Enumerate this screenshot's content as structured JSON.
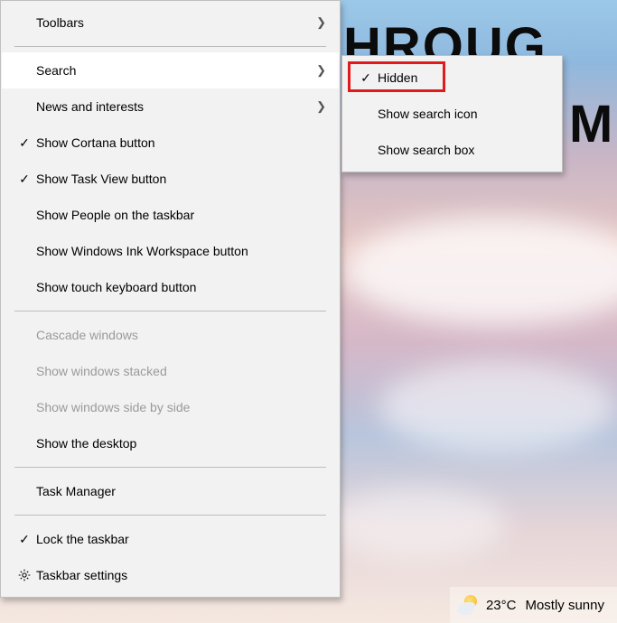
{
  "background": {
    "text_fragment_1": "HROUG",
    "text_fragment_2": "M"
  },
  "main_menu": {
    "items": [
      {
        "label": "Toolbars",
        "icon": null,
        "has_submenu": true,
        "enabled": true
      },
      {
        "label": "Search",
        "icon": null,
        "has_submenu": true,
        "enabled": true,
        "hovered": true
      },
      {
        "label": "News and interests",
        "icon": null,
        "has_submenu": true,
        "enabled": true
      },
      {
        "label": "Show Cortana button",
        "icon": "check",
        "enabled": true
      },
      {
        "label": "Show Task View button",
        "icon": "check",
        "enabled": true
      },
      {
        "label": "Show People on the taskbar",
        "icon": null,
        "enabled": true
      },
      {
        "label": "Show Windows Ink Workspace button",
        "icon": null,
        "enabled": true
      },
      {
        "label": "Show touch keyboard button",
        "icon": null,
        "enabled": true
      },
      {
        "label": "Cascade windows",
        "icon": null,
        "enabled": false
      },
      {
        "label": "Show windows stacked",
        "icon": null,
        "enabled": false
      },
      {
        "label": "Show windows side by side",
        "icon": null,
        "enabled": false
      },
      {
        "label": "Show the desktop",
        "icon": null,
        "enabled": true
      },
      {
        "label": "Task Manager",
        "icon": null,
        "enabled": true
      },
      {
        "label": "Lock the taskbar",
        "icon": "check",
        "enabled": true
      },
      {
        "label": "Taskbar settings",
        "icon": "gear",
        "enabled": true
      }
    ],
    "separators_after": [
      0,
      7,
      11,
      12
    ]
  },
  "sub_menu": {
    "parent": "Search",
    "items": [
      {
        "label": "Hidden",
        "icon": "check",
        "selected": true,
        "highlighted": true
      },
      {
        "label": "Show search icon",
        "icon": null
      },
      {
        "label": "Show search box",
        "icon": null
      }
    ]
  },
  "weather": {
    "temperature": "23°C",
    "condition": "Mostly sunny"
  },
  "highlight_color": "#e11b1b"
}
